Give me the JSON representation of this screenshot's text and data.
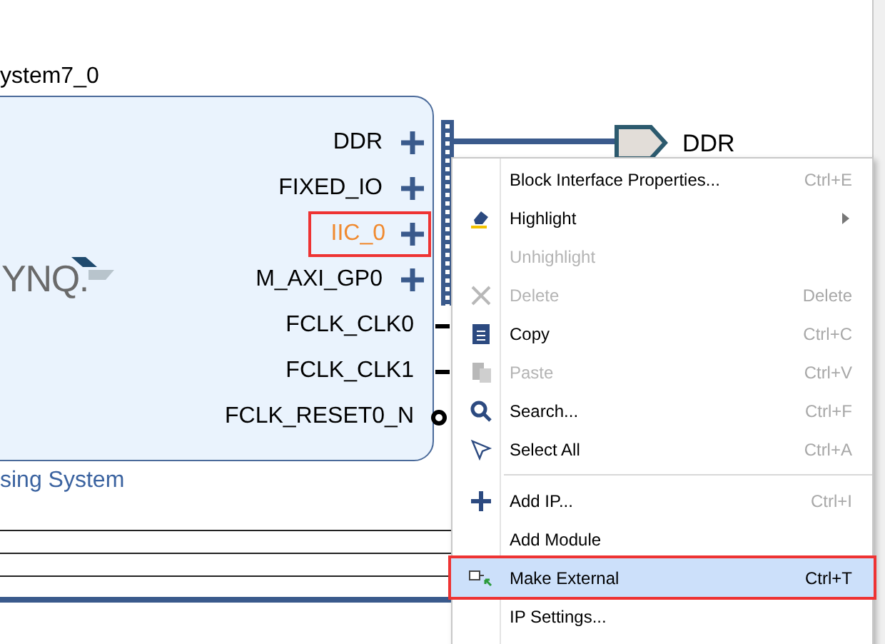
{
  "block": {
    "title": "ystem7_0",
    "caption": "sing System",
    "logo": "YNQ.",
    "ports": [
      {
        "name": "DDR",
        "kind": "bus",
        "selected": false
      },
      {
        "name": "FIXED_IO",
        "kind": "bus",
        "selected": false
      },
      {
        "name": "IIC_0",
        "kind": "bus",
        "selected": true
      },
      {
        "name": "M_AXI_GP0",
        "kind": "bus",
        "selected": false
      },
      {
        "name": "FCLK_CLK0",
        "kind": "clock",
        "selected": false
      },
      {
        "name": "FCLK_CLK1",
        "kind": "clock",
        "selected": false
      },
      {
        "name": "FCLK_RESET0_N",
        "kind": "reset",
        "selected": false
      }
    ]
  },
  "external_port": {
    "label": "DDR"
  },
  "context_menu": {
    "items": [
      {
        "kind": "item",
        "label": "Block Interface Properties...",
        "shortcut": "Ctrl+E",
        "disabled": false,
        "selected": false
      },
      {
        "kind": "item",
        "label": "Highlight",
        "disabled": false,
        "submenu": true,
        "selected": false
      },
      {
        "kind": "item",
        "label": "Unhighlight",
        "disabled": true,
        "selected": false
      },
      {
        "kind": "item",
        "label": "Delete",
        "shortcut": "Delete",
        "disabled": true,
        "selected": false
      },
      {
        "kind": "item",
        "label": "Copy",
        "shortcut": "Ctrl+C",
        "disabled": false,
        "selected": false
      },
      {
        "kind": "item",
        "label": "Paste",
        "shortcut": "Ctrl+V",
        "disabled": true,
        "selected": false
      },
      {
        "kind": "item",
        "label": "Search...",
        "shortcut": "Ctrl+F",
        "disabled": false,
        "selected": false
      },
      {
        "kind": "item",
        "label": "Select All",
        "shortcut": "Ctrl+A",
        "disabled": false,
        "selected": false
      },
      {
        "kind": "separator"
      },
      {
        "kind": "item",
        "label": "Add IP...",
        "shortcut": "Ctrl+I",
        "disabled": false,
        "selected": false
      },
      {
        "kind": "item",
        "label": "Add Module",
        "disabled": false,
        "selected": false
      },
      {
        "kind": "item",
        "label": "Make External",
        "shortcut": "Ctrl+T",
        "disabled": false,
        "selected": true
      },
      {
        "kind": "item",
        "label": "IP Settings...",
        "disabled": false,
        "selected": false
      }
    ]
  }
}
